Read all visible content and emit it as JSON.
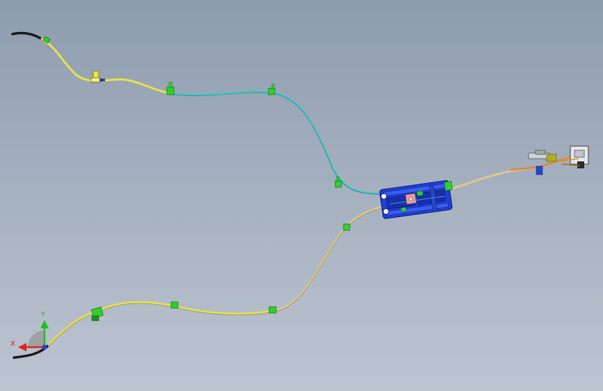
{
  "viewport": {
    "background_top": "#8e9cae",
    "background_bottom": "#bcc4d0"
  },
  "colors": {
    "cable_yellow": "#e6e24a",
    "cable_cyan": "#3fc7c7",
    "cable_tan": "#dcc98a",
    "cable_orange": "#e08a2a",
    "cable_black": "#1a1a1a",
    "clip_green": "#2fd12f",
    "actuator_blue": "#1f3fd6",
    "actuator_dark": "#10208a",
    "axis_x": "#e02020",
    "axis_y": "#20c020",
    "axis_z": "#2040e0"
  },
  "triad": {
    "x_label": "X",
    "y_label": "Y"
  }
}
